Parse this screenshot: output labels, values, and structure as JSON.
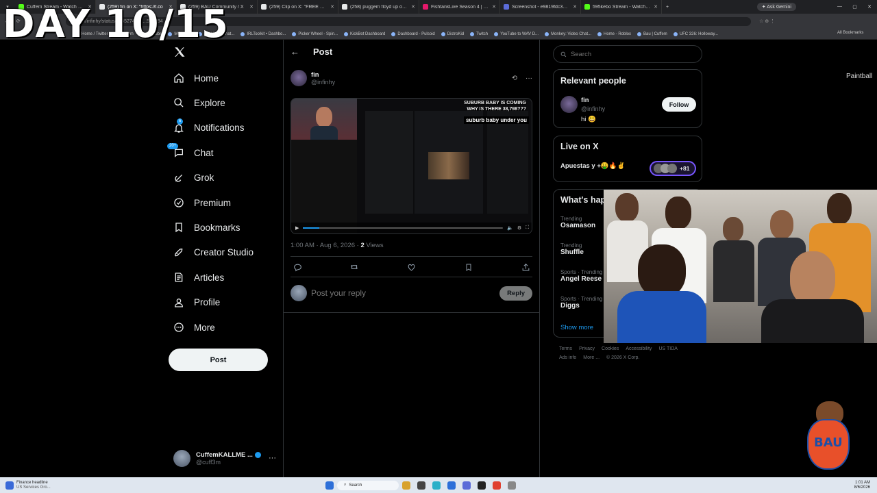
{
  "overlay": {
    "day_label": "DAY 10/15"
  },
  "browser": {
    "tabs": [
      {
        "title": "Cuffem Stream - Watch Live on",
        "color": "#53fc18",
        "active": false
      },
      {
        "title": "(259) fin on X: \"https://t.co",
        "color": "#e7e9ea",
        "active": true
      },
      {
        "title": "(259) BAU Community / X",
        "color": "#e7e9ea",
        "active": false
      },
      {
        "title": "(259) Clip on X: \"FREE SWEA",
        "color": "#e7e9ea",
        "active": false
      },
      {
        "title": "(258) puggem floyd up on X: \"",
        "color": "#e7e9ea",
        "active": false
      },
      {
        "title": "FishtankLive Season 4 | Freddy",
        "color": "#e5186b",
        "active": false
      },
      {
        "title": "Screenshot - e9819fdc3891bcd",
        "color": "#5b6bd8",
        "active": false
      },
      {
        "title": "595kebo Stream - Watch Live o",
        "color": "#53fc18",
        "active": false
      }
    ],
    "new_tab": "+",
    "ask_gemini": "Ask Gemini",
    "address_url": "x.com/infinhy/status/2085274752...555384",
    "bookmarks": [
      "Home / Twitter",
      "Cuffem",
      "YouTube",
      "MONKEY",
      "TV Video Chat...",
      "IRLToolkit • Dashbo...",
      "Picker Wheel - Spin...",
      "KickBot Dashboard",
      "Dashboard - Pulsoid",
      "DistroKid",
      "Twitch",
      "YouTube to WAV D...",
      "Monkey: Video Chat...",
      "Home - Roblox",
      "Bau | Cuffem",
      "UFC 326: Holloway..."
    ],
    "all_bookmarks": "All Bookmarks"
  },
  "nav": {
    "items": [
      {
        "label": "Home",
        "icon": "home-icon"
      },
      {
        "label": "Explore",
        "icon": "search-icon"
      },
      {
        "label": "Notifications",
        "icon": "bell-icon",
        "badge": "6"
      },
      {
        "label": "Chat",
        "icon": "chat-icon",
        "badge": "20+"
      },
      {
        "label": "Grok",
        "icon": "grok-icon"
      },
      {
        "label": "Premium",
        "icon": "premium-icon"
      },
      {
        "label": "Bookmarks",
        "icon": "bookmark-icon"
      },
      {
        "label": "Creator Studio",
        "icon": "rocket-icon"
      },
      {
        "label": "Articles",
        "icon": "articles-icon"
      },
      {
        "label": "Profile",
        "icon": "profile-icon"
      },
      {
        "label": "More",
        "icon": "more-icon"
      }
    ],
    "post_label": "Post",
    "account": {
      "name": "CuffemKALLME ...",
      "handle": "@cuff3m"
    }
  },
  "post": {
    "header": "Post",
    "author": "fin",
    "handle": "@infinhy",
    "timestamp": "1:00 AM · Aug 6, 2026 ·",
    "views_count": "2",
    "views_label": "Views",
    "reply_placeholder": "Post your reply",
    "reply_button": "Reply",
    "media": {
      "caption_top": "SUBURB BABY IS COMING",
      "caption_mid": "WHY IS THERE 38,798???",
      "caption_side": "suburb baby under you"
    }
  },
  "sidebar": {
    "search_placeholder": "Search",
    "relevant_title": "Relevant people",
    "relevant": {
      "name": "fin",
      "handle": "@infinhy",
      "bio": "hi 😃",
      "follow": "Follow"
    },
    "live_title": "Live on X",
    "live": {
      "title": "Apuestas y +🤑🔥✌",
      "count": "+81"
    },
    "happening_title": "What's happening",
    "trends": [
      {
        "context": "Trending",
        "name": "Osamason"
      },
      {
        "context": "Trending",
        "name": "Shuffle"
      },
      {
        "context": "Sports · Trending",
        "name": "Angel Reese"
      },
      {
        "context": "Sports · Trending",
        "name": "Diggs"
      }
    ],
    "show_more": "Show more",
    "footer": [
      "Terms",
      "Privacy",
      "Cookies",
      "Accessibility",
      "US TIDA",
      "Ads info",
      "More ...",
      "© 2026 X Corp."
    ]
  },
  "misc": {
    "paintball": "Paintball",
    "bau_logo": "BAU"
  },
  "taskbar": {
    "weather_title": "Finance headline",
    "weather_sub": "US Services Gro...",
    "search": "Search",
    "time": "1:01 AM",
    "date": "8/6/2026"
  }
}
